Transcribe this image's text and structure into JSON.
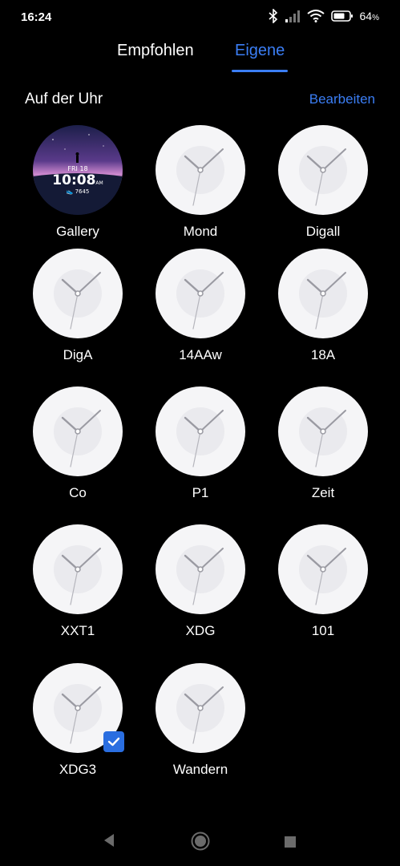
{
  "status_bar": {
    "time": "16:24",
    "battery": "64",
    "battery_unit": "%"
  },
  "tabs": [
    {
      "label": "Empfohlen"
    },
    {
      "label": "Eigene"
    }
  ],
  "section": {
    "title": "Auf der Uhr",
    "edit_label": "Bearbeiten"
  },
  "gallery_preview": {
    "date": "FRI 18",
    "time": "10:08",
    "ampm": "AM",
    "steps": "7645"
  },
  "faces": [
    {
      "label": "Gallery"
    },
    {
      "label": "Mond"
    },
    {
      "label": "Digall"
    },
    {
      "label": "DigA"
    },
    {
      "label": "14AAw"
    },
    {
      "label": "18A"
    },
    {
      "label": "Co"
    },
    {
      "label": "P1"
    },
    {
      "label": "Zeit"
    },
    {
      "label": "XXT1"
    },
    {
      "label": "XDG"
    },
    {
      "label": "101"
    },
    {
      "label": "XDG3",
      "selected": true
    },
    {
      "label": "Wandern"
    }
  ],
  "colors": {
    "accent": "#3b7ef5",
    "background": "#000000",
    "check": "#2a6ee0"
  },
  "nav": {
    "icons": [
      "back-icon",
      "home-icon",
      "recents-icon"
    ]
  }
}
